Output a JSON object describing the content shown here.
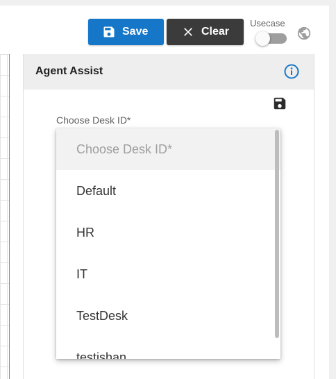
{
  "toolbar": {
    "save_label": "Save",
    "clear_label": "Clear",
    "usecase_label": "Usecase",
    "usecase_enabled": false
  },
  "panel": {
    "title": "Agent Assist"
  },
  "desk_field": {
    "label": "Choose Desk ID*",
    "placeholder": "Choose Desk ID*",
    "options": [
      "Default",
      "HR",
      "IT",
      "TestDesk",
      "testishan"
    ]
  },
  "colors": {
    "save_button": "#1677c9",
    "clear_button": "#3b3b3b",
    "info_icon": "#1677c9"
  },
  "icons": {
    "save": "floppy-disk-icon",
    "clear": "close-icon",
    "globe": "globe-icon",
    "info": "info-icon"
  }
}
